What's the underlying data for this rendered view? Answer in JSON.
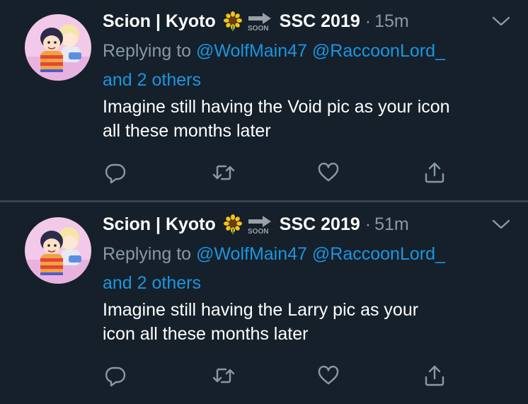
{
  "tweets": [
    {
      "author": "Scion | Kyoto",
      "emoji": [
        "sunflower",
        "soon-arrow"
      ],
      "event": "SSC 2019",
      "dot": "·",
      "time": "15m",
      "replying_prefix": "Replying to",
      "mention1": "@WolfMain47",
      "mention2": "@RaccoonLord_",
      "others": "and 2 others",
      "text_line1": "Imagine still having the Void pic as your icon",
      "text_line2": "all these months later",
      "icons": [
        "reply-icon",
        "retweet-icon",
        "like-icon",
        "share-icon"
      ]
    },
    {
      "author": "Scion | Kyoto",
      "emoji": [
        "sunflower",
        "soon-arrow"
      ],
      "event": "SSC 2019",
      "dot": "·",
      "time": "51m",
      "replying_prefix": "Replying to",
      "mention1": "@WolfMain47",
      "mention2": "@RaccoonLord_",
      "others": "and 2 others",
      "text_line1": "Imagine still having the Larry pic as your",
      "text_line2": "icon all these months later",
      "icons": [
        "reply-icon",
        "retweet-icon",
        "like-icon",
        "share-icon"
      ]
    }
  ],
  "colors": {
    "background": "#15202b",
    "divider": "#38444d",
    "secondary_text": "#8899a6",
    "link": "#1b95e0",
    "primary_text": "#ffffff"
  }
}
